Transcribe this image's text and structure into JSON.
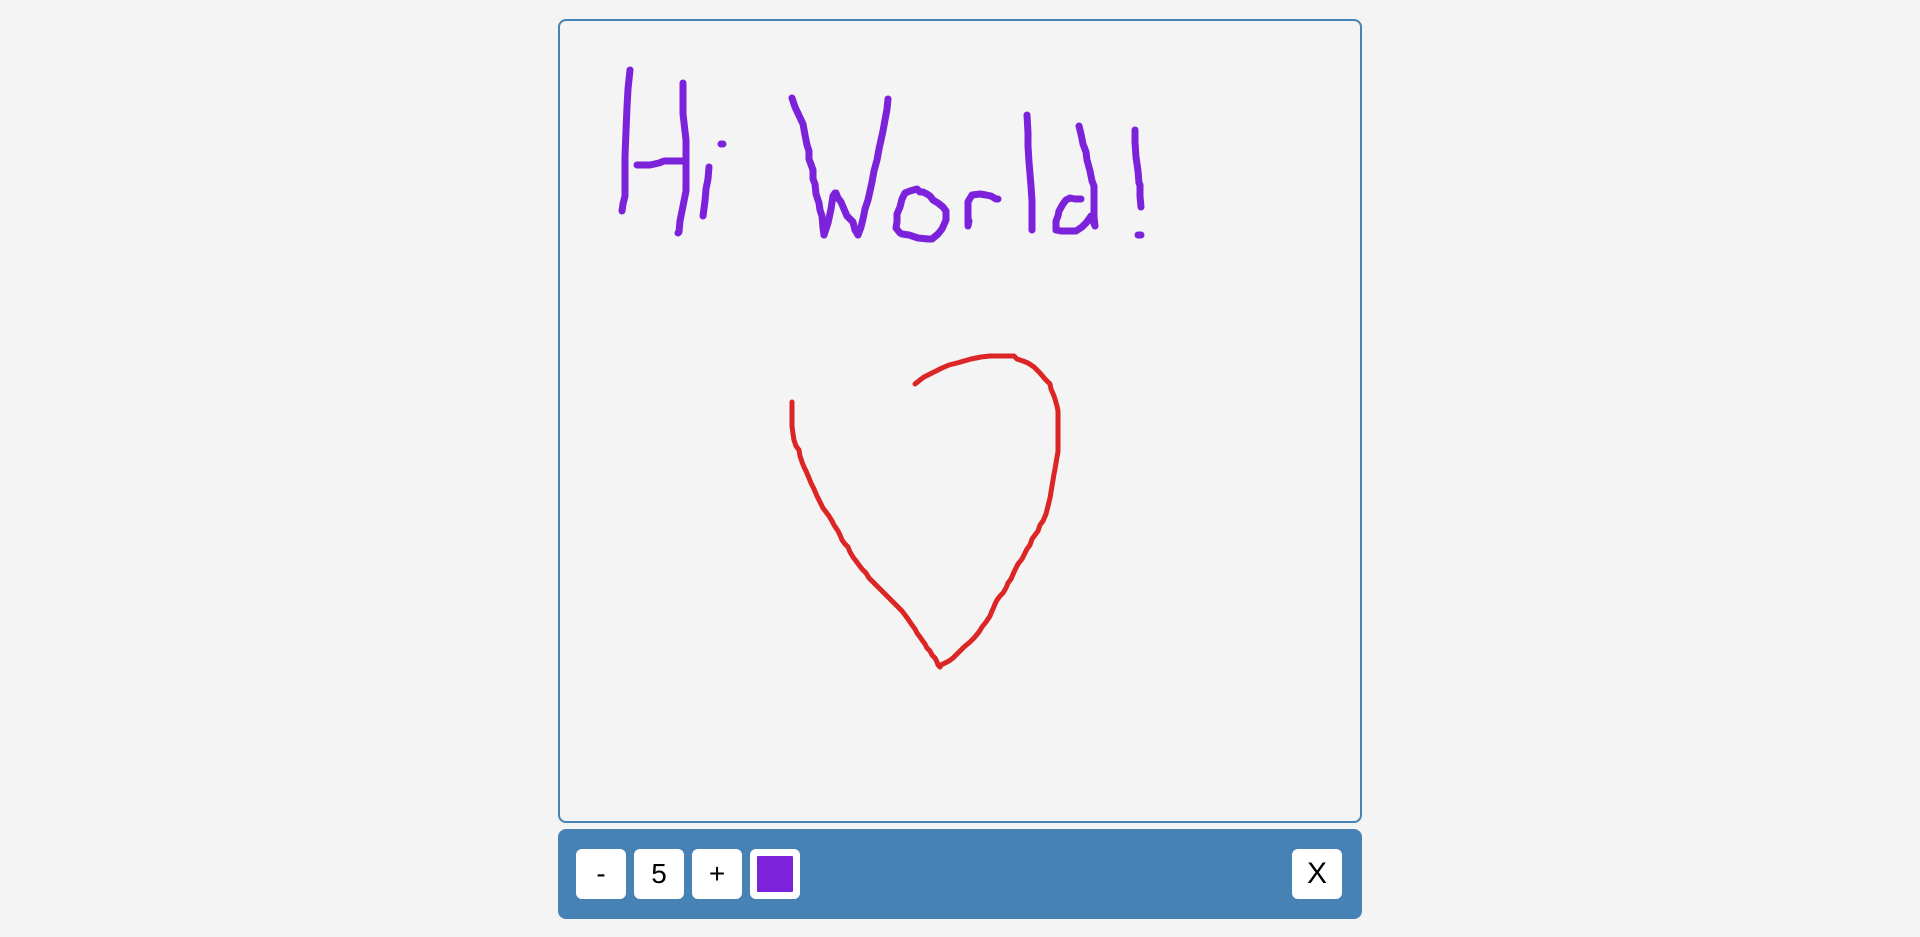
{
  "canvas": {
    "text_drawn": "Hi World!"
  },
  "toolbar": {
    "decrease_label": "-",
    "size_value": "5",
    "increase_label": "+",
    "current_color": "#7c22db",
    "clear_label": "X"
  },
  "colors": {
    "accent": "#4682b4",
    "background": "#f4f4f4",
    "text_stroke": "#7c22db",
    "heart_stroke": "#dc2626"
  }
}
